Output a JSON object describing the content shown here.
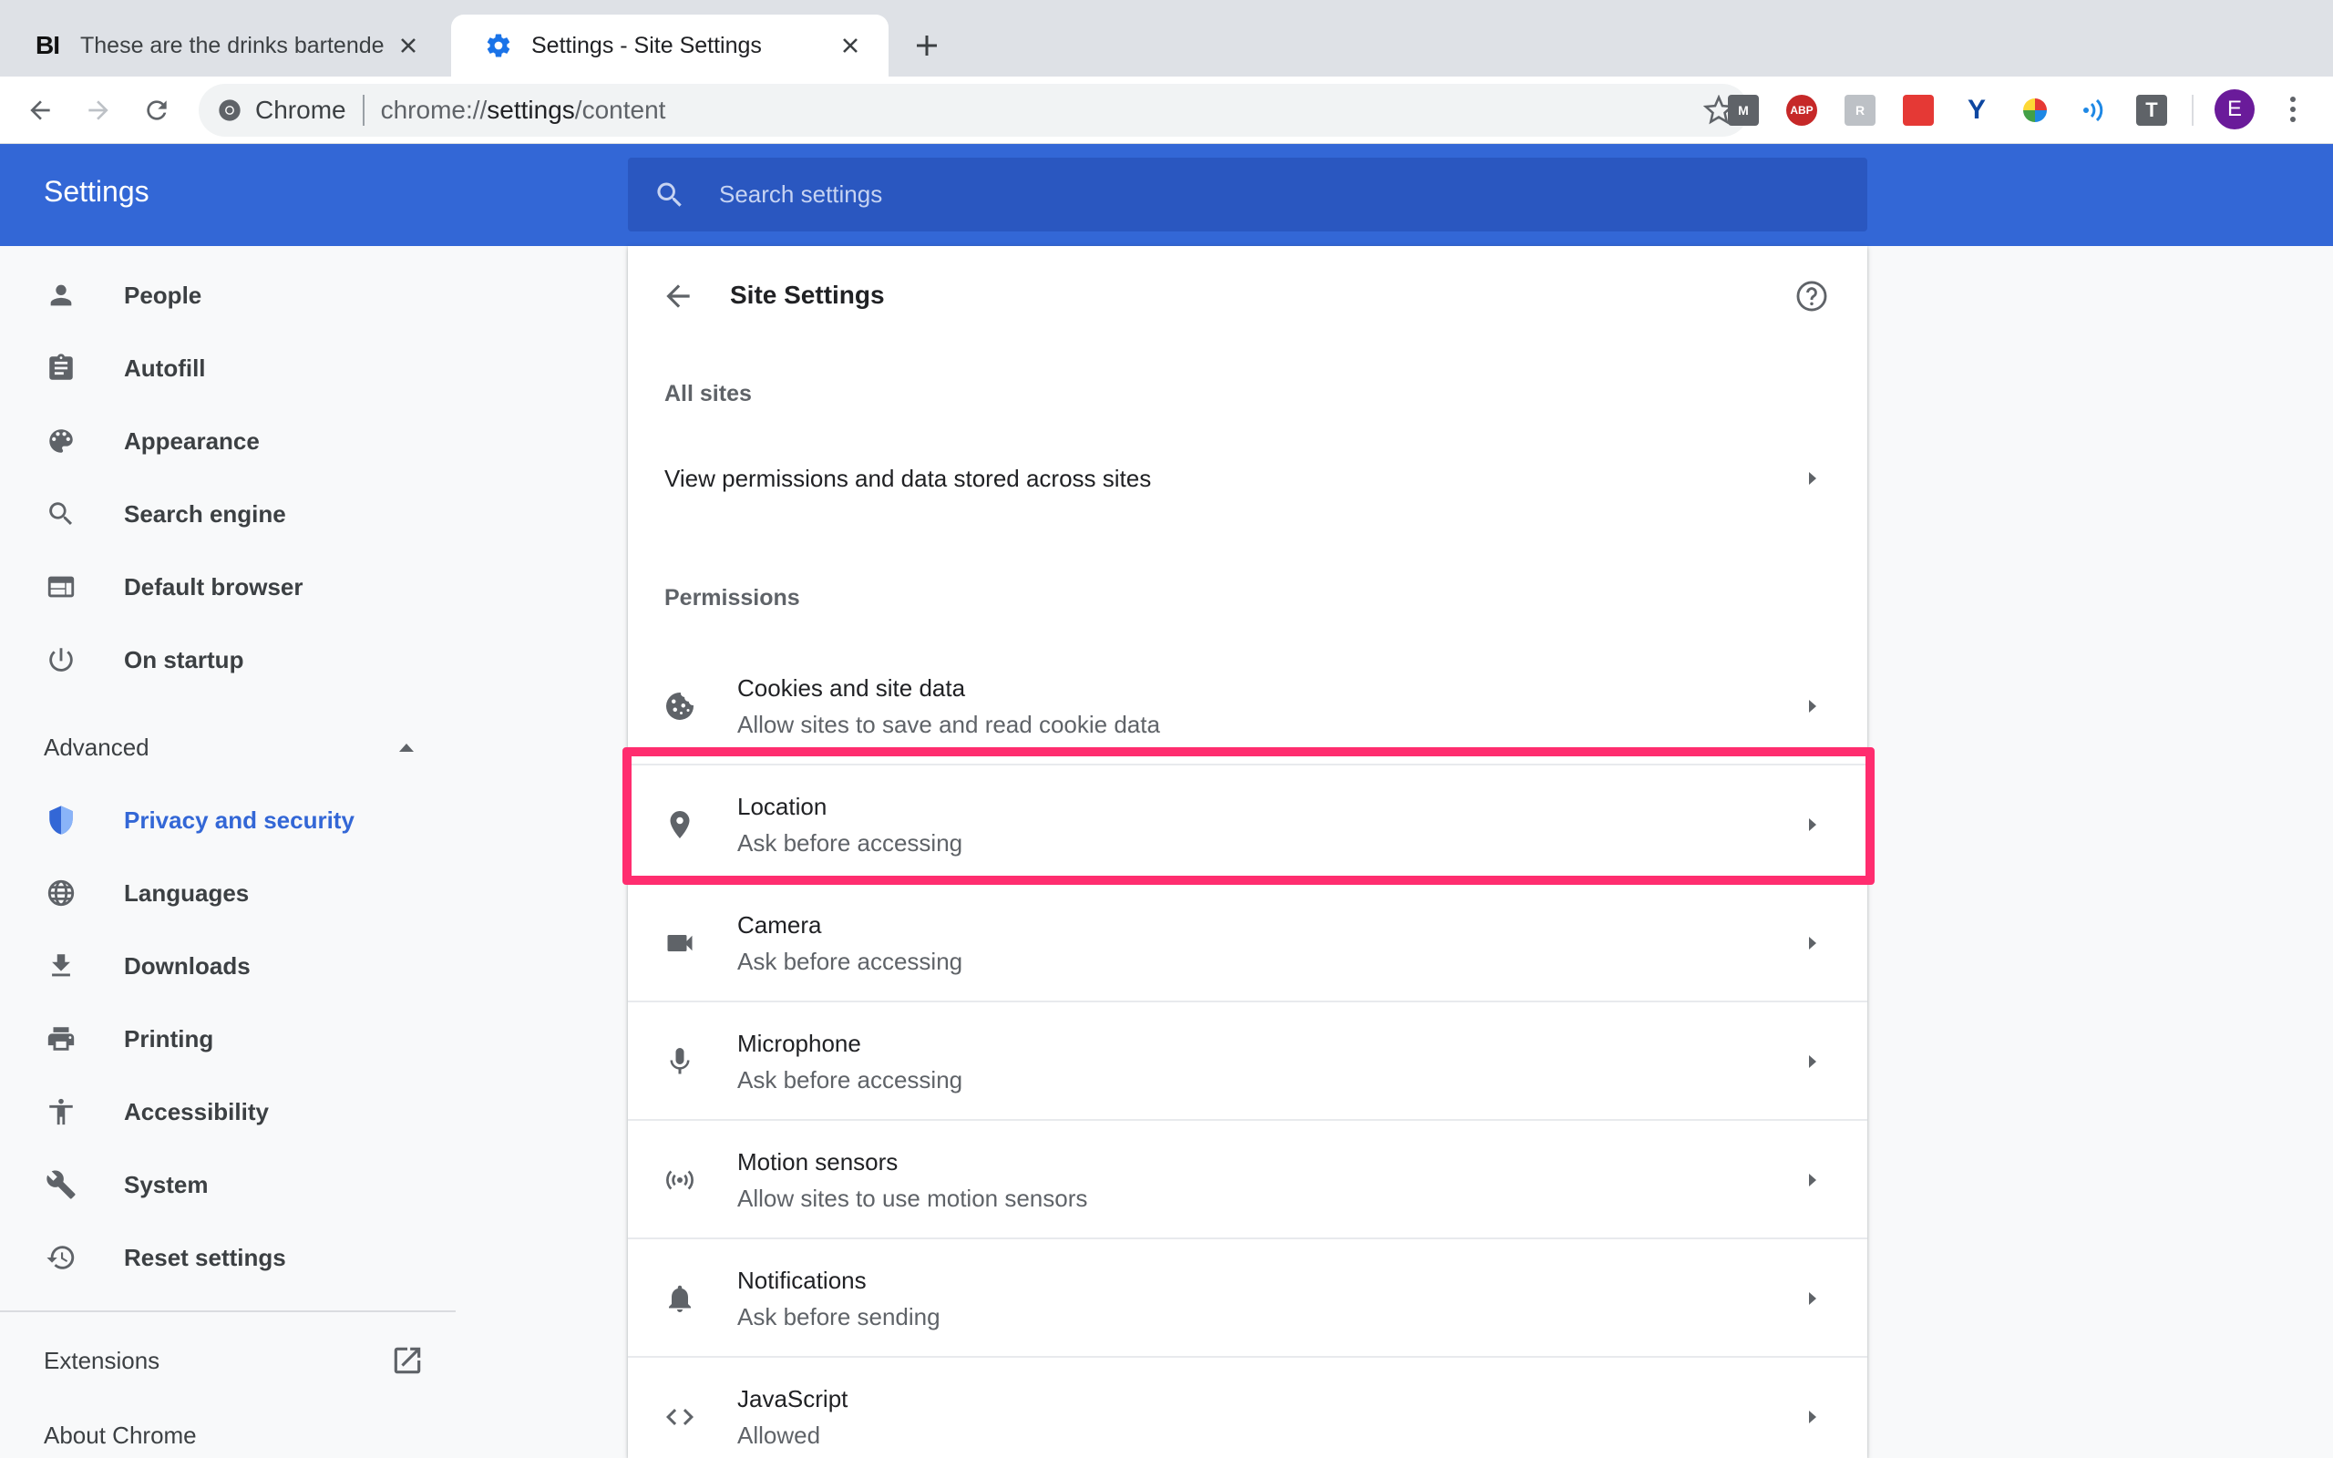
{
  "browser": {
    "tabs": [
      {
        "title": "These are the drinks bartenders",
        "favicon": "BI",
        "active": false
      },
      {
        "title": "Settings - Site Settings",
        "favicon": "gear-icon",
        "active": true
      }
    ],
    "omnibox": {
      "site_chip": "Chrome",
      "url_prefix": "chrome://",
      "url_host": "settings",
      "url_path": "/content"
    },
    "extensions": [
      {
        "name": "m-extension",
        "label": "M",
        "color": "#5f6368"
      },
      {
        "name": "adblock-plus",
        "label": "ABP",
        "color": "#c62828"
      },
      {
        "name": "grey-extension",
        "label": "R",
        "color": "#9aa0a6"
      },
      {
        "name": "red-extension",
        "label": "",
        "color": "#e53935"
      },
      {
        "name": "y-extension",
        "label": "Y",
        "color": "#0d47a1"
      },
      {
        "name": "color-wheel-extension",
        "label": "",
        "color": "#43a047"
      },
      {
        "name": "signal-extension",
        "label": "",
        "color": "#1e88e5"
      },
      {
        "name": "t-extension",
        "label": "T",
        "color": "#5f6368"
      }
    ],
    "avatar_letter": "E"
  },
  "header": {
    "title": "Settings",
    "search_placeholder": "Search settings"
  },
  "sidebar": {
    "items": [
      {
        "label": "People",
        "icon": "person-icon"
      },
      {
        "label": "Autofill",
        "icon": "clipboard-icon"
      },
      {
        "label": "Appearance",
        "icon": "palette-icon"
      },
      {
        "label": "Search engine",
        "icon": "search-icon"
      },
      {
        "label": "Default browser",
        "icon": "browser-icon"
      },
      {
        "label": "On startup",
        "icon": "power-icon"
      }
    ],
    "advanced_label": "Advanced",
    "advanced_items": [
      {
        "label": "Privacy and security",
        "icon": "shield-icon",
        "selected": true
      },
      {
        "label": "Languages",
        "icon": "globe-icon"
      },
      {
        "label": "Downloads",
        "icon": "download-icon"
      },
      {
        "label": "Printing",
        "icon": "printer-icon"
      },
      {
        "label": "Accessibility",
        "icon": "accessibility-icon"
      },
      {
        "label": "System",
        "icon": "wrench-icon"
      },
      {
        "label": "Reset settings",
        "icon": "restore-icon"
      }
    ],
    "extensions_label": "Extensions",
    "about_label": "About Chrome"
  },
  "main": {
    "title": "Site Settings",
    "all_sites_label": "All sites",
    "all_sites_row": "View permissions and data stored across sites",
    "permissions_label": "Permissions",
    "permissions": [
      {
        "title": "Cookies and site data",
        "subtitle": "Allow sites to save and read cookie data",
        "icon": "cookie-icon"
      },
      {
        "title": "Location",
        "subtitle": "Ask before accessing",
        "icon": "location-pin-icon",
        "highlighted": true
      },
      {
        "title": "Camera",
        "subtitle": "Ask before accessing",
        "icon": "camera-icon"
      },
      {
        "title": "Microphone",
        "subtitle": "Ask before accessing",
        "icon": "microphone-icon"
      },
      {
        "title": "Motion sensors",
        "subtitle": "Allow sites to use motion sensors",
        "icon": "motion-sensor-icon"
      },
      {
        "title": "Notifications",
        "subtitle": "Ask before sending",
        "icon": "bell-icon"
      },
      {
        "title": "JavaScript",
        "subtitle": "Allowed",
        "icon": "code-icon"
      }
    ]
  },
  "colors": {
    "accent": "#3367d6",
    "highlight": "#ff2d6f",
    "search_bg": "#2a57c0"
  }
}
